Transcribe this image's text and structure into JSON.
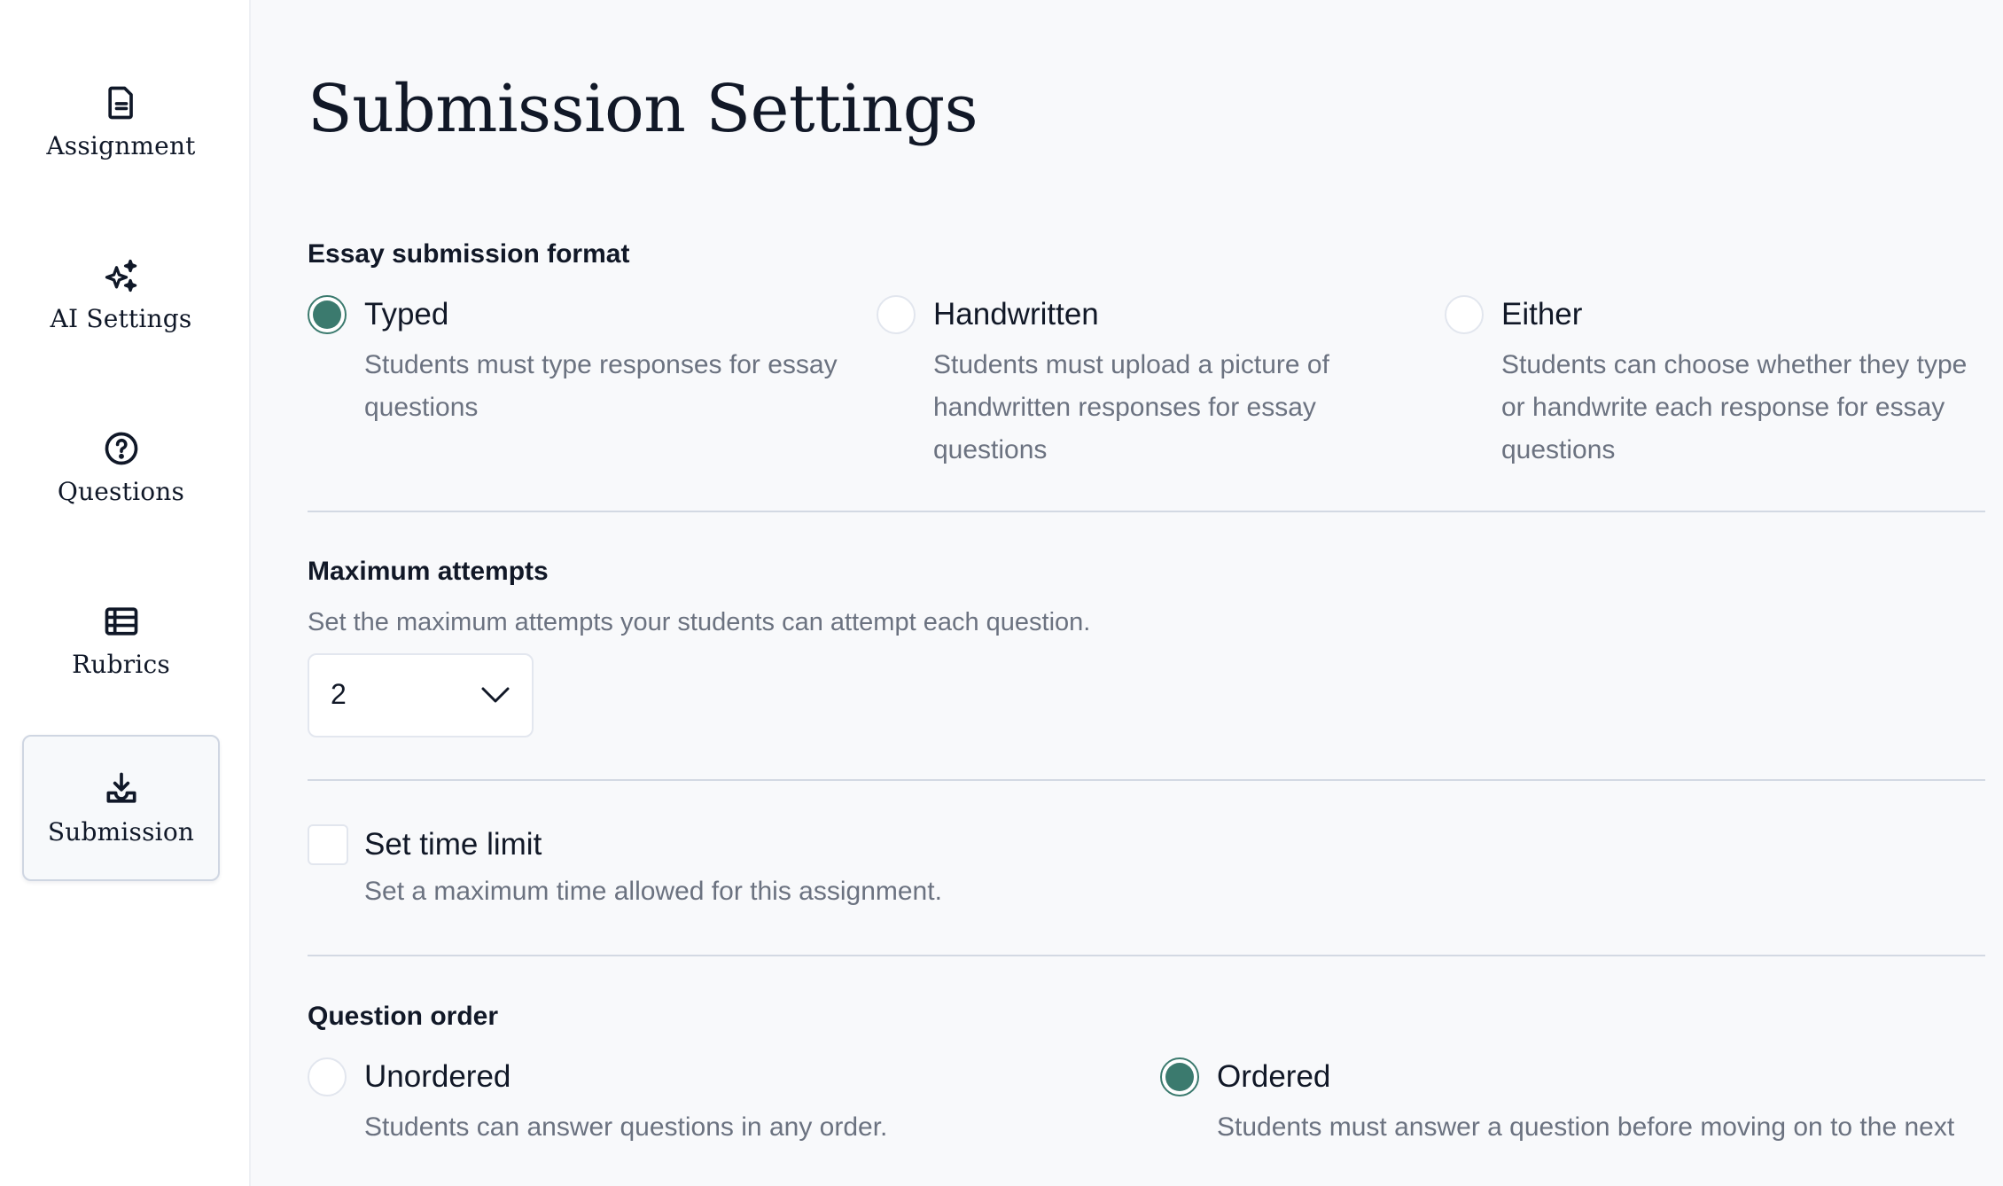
{
  "sidebar": {
    "items": [
      {
        "label": "Assignment",
        "icon": "document-icon",
        "active": false
      },
      {
        "label": "AI Settings",
        "icon": "sparkles-icon",
        "active": false
      },
      {
        "label": "Questions",
        "icon": "question-circle-icon",
        "active": false
      },
      {
        "label": "Rubrics",
        "icon": "table-icon",
        "active": false
      },
      {
        "label": "Submission",
        "icon": "download-tray-icon",
        "active": true
      }
    ]
  },
  "main": {
    "title": "Submission Settings",
    "essay_format": {
      "label": "Essay submission format",
      "selected": "Typed",
      "options": [
        {
          "title": "Typed",
          "description": "Students must type responses for essay questions",
          "checked": true
        },
        {
          "title": "Handwritten",
          "description": "Students must upload a picture of handwritten responses for essay questions",
          "checked": false
        },
        {
          "title": "Either",
          "description": "Students can choose whether they type or handwrite each response for essay questions",
          "checked": false
        }
      ]
    },
    "max_attempts": {
      "label": "Maximum attempts",
      "help": "Set the maximum attempts your students can attempt each question.",
      "value": "2"
    },
    "time_limit": {
      "label": "Set time limit",
      "help": "Set a maximum time allowed for this assignment.",
      "checked": false
    },
    "question_order": {
      "label": "Question order",
      "selected": "Ordered",
      "options": [
        {
          "title": "Unordered",
          "description": "Students can answer questions in any order.",
          "checked": false
        },
        {
          "title": "Ordered",
          "description": "Students must answer a question before moving on to the next",
          "checked": true
        }
      ]
    }
  },
  "colors": {
    "accent": "#3b7a6e",
    "text": "#111827",
    "muted": "#6b7280",
    "divider": "#d3d9e3",
    "background": "#f8f9fb"
  }
}
